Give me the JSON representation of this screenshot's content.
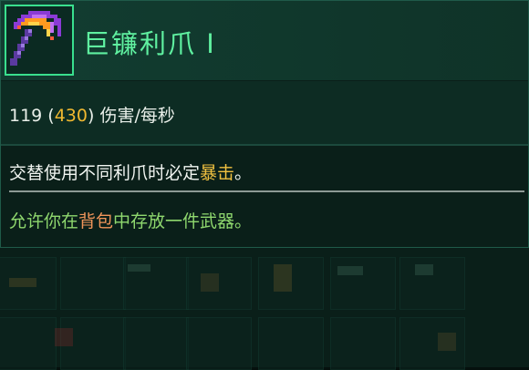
{
  "item": {
    "name": "巨镰利爪 I",
    "icon": "scythe-claw-icon"
  },
  "damage": {
    "base": "119",
    "open_paren": " (",
    "crit": "430",
    "close_paren": ")",
    "unit": " 伤害/每秒"
  },
  "description": {
    "before": "交替使用不同利爪时必定",
    "keyword": "暴击",
    "after": "。"
  },
  "perk": {
    "before": "允许你在",
    "keyword": "背包",
    "after": "中存放一件武器。"
  },
  "colors": {
    "name": "#5ff0a0",
    "crit": "#f0b830",
    "keyword": "#f0c040",
    "perk": "#8fd86e",
    "perk_keyword": "#f0955a"
  }
}
